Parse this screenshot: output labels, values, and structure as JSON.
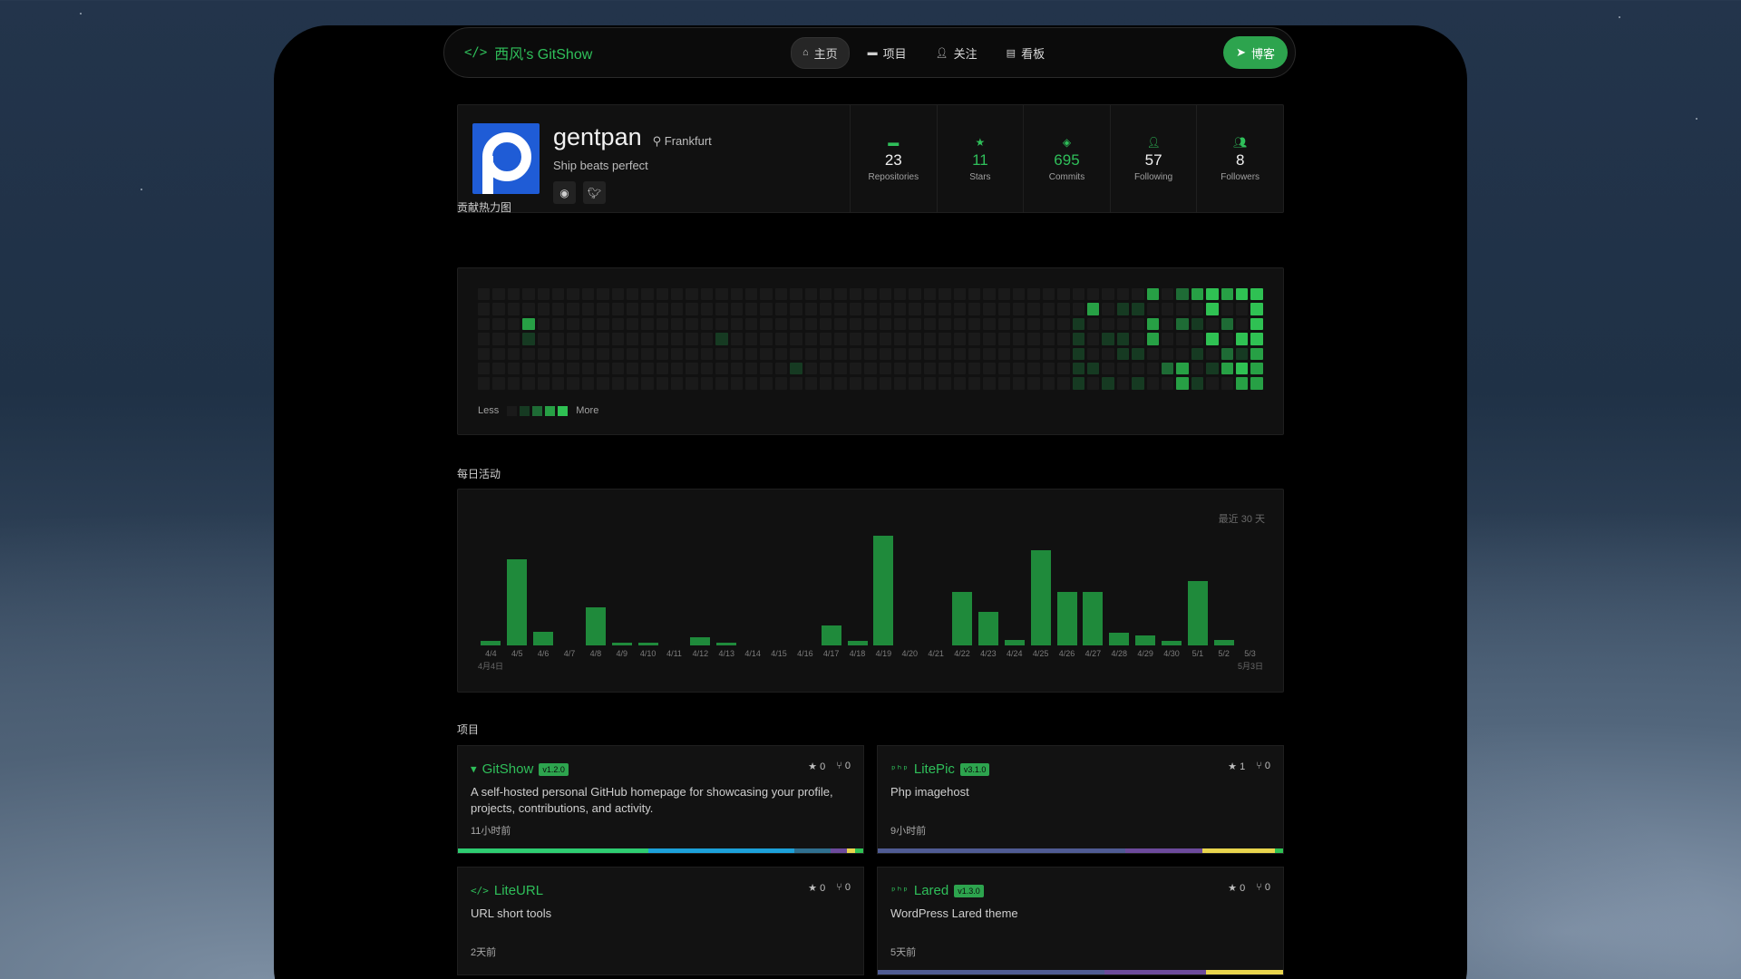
{
  "nav": {
    "brand": "西风's GitShow",
    "links": [
      {
        "label": "主页",
        "icon": "home-icon",
        "active": true
      },
      {
        "label": "项目",
        "icon": "folder-icon",
        "active": false
      },
      {
        "label": "关注",
        "icon": "user-plus-icon",
        "active": false
      },
      {
        "label": "看板",
        "icon": "chart-icon",
        "active": false
      }
    ],
    "blog_label": "博客"
  },
  "profile": {
    "username": "gentpan",
    "location": "Frankfurt",
    "bio": "Ship beats perfect",
    "stats": [
      {
        "value": "23",
        "label": "Repositories",
        "icon": "folder-icon",
        "green": false
      },
      {
        "value": "11",
        "label": "Stars",
        "icon": "star-icon",
        "green": true
      },
      {
        "value": "695",
        "label": "Commits",
        "icon": "commit-icon",
        "green": true
      },
      {
        "value": "57",
        "label": "Following",
        "icon": "user-plus-icon",
        "green": false
      },
      {
        "value": "8",
        "label": "Followers",
        "icon": "users-icon",
        "green": false
      }
    ]
  },
  "heatmap": {
    "title": "贡献热力图",
    "legend_less": "Less",
    "legend_more": "More",
    "colors": [
      "#1a1a1a",
      "#163a22",
      "#1e6b35",
      "#27a045",
      "#2fc153"
    ]
  },
  "activity": {
    "title": "每日活动",
    "caption": "最近 30 天",
    "date_start": "4月4日",
    "date_end": "5月3日",
    "chart_data": {
      "type": "bar",
      "categories": [
        "4/4",
        "4/5",
        "4/6",
        "4/7",
        "4/8",
        "4/9",
        "4/10",
        "4/11",
        "4/12",
        "4/13",
        "4/14",
        "4/15",
        "4/16",
        "4/17",
        "4/18",
        "4/19",
        "4/20",
        "4/21",
        "4/22",
        "4/23",
        "4/24",
        "4/25",
        "4/26",
        "4/27",
        "4/28",
        "4/29",
        "4/30",
        "5/1",
        "5/2",
        "5/3"
      ],
      "values": [
        3,
        61,
        10,
        0,
        27,
        2,
        2,
        0,
        6,
        2,
        0,
        0,
        0,
        14,
        3,
        78,
        0,
        0,
        38,
        24,
        4,
        68,
        38,
        38,
        9,
        7,
        3,
        46,
        4,
        0
      ],
      "ylim": [
        0,
        80
      ]
    }
  },
  "projects": {
    "title": "项目",
    "items": [
      {
        "name": "GitShow",
        "version": "v1.2.0",
        "icon": "filter-icon",
        "stars": "0",
        "forks": "0",
        "desc": "A self-hosted personal GitHub homepage for showcasing your profile, projects, contributions, and activity.",
        "time": "11小时前",
        "languages": [
          {
            "color": "#2ecc71",
            "pct": 47
          },
          {
            "color": "#1ca0d8",
            "pct": 36
          },
          {
            "color": "#2f6f8f",
            "pct": 9
          },
          {
            "color": "#6c4a9b",
            "pct": 4
          },
          {
            "color": "#e8d44d",
            "pct": 2
          },
          {
            "color": "#2fc153",
            "pct": 2
          }
        ]
      },
      {
        "name": "LitePic",
        "version": "v3.1.0",
        "icon": "php-icon",
        "stars": "1",
        "forks": "0",
        "desc": "Php imagehost",
        "time": "9小时前",
        "languages": [
          {
            "color": "#4f5b93",
            "pct": 61
          },
          {
            "color": "#6c4a9b",
            "pct": 19
          },
          {
            "color": "#e8d44d",
            "pct": 18
          },
          {
            "color": "#2fc153",
            "pct": 2
          }
        ]
      },
      {
        "name": "LiteURL",
        "version": "",
        "icon": "code-icon",
        "stars": "0",
        "forks": "0",
        "desc": "URL short tools",
        "time": "2天前",
        "languages": []
      },
      {
        "name": "Lared",
        "version": "v1.3.0",
        "icon": "php-icon",
        "stars": "0",
        "forks": "0",
        "desc": "WordPress Lared theme",
        "time": "5天前",
        "languages": [
          {
            "color": "#4f5b93",
            "pct": 56
          },
          {
            "color": "#6c4a9b",
            "pct": 25
          },
          {
            "color": "#e8d44d",
            "pct": 19
          }
        ]
      }
    ]
  }
}
